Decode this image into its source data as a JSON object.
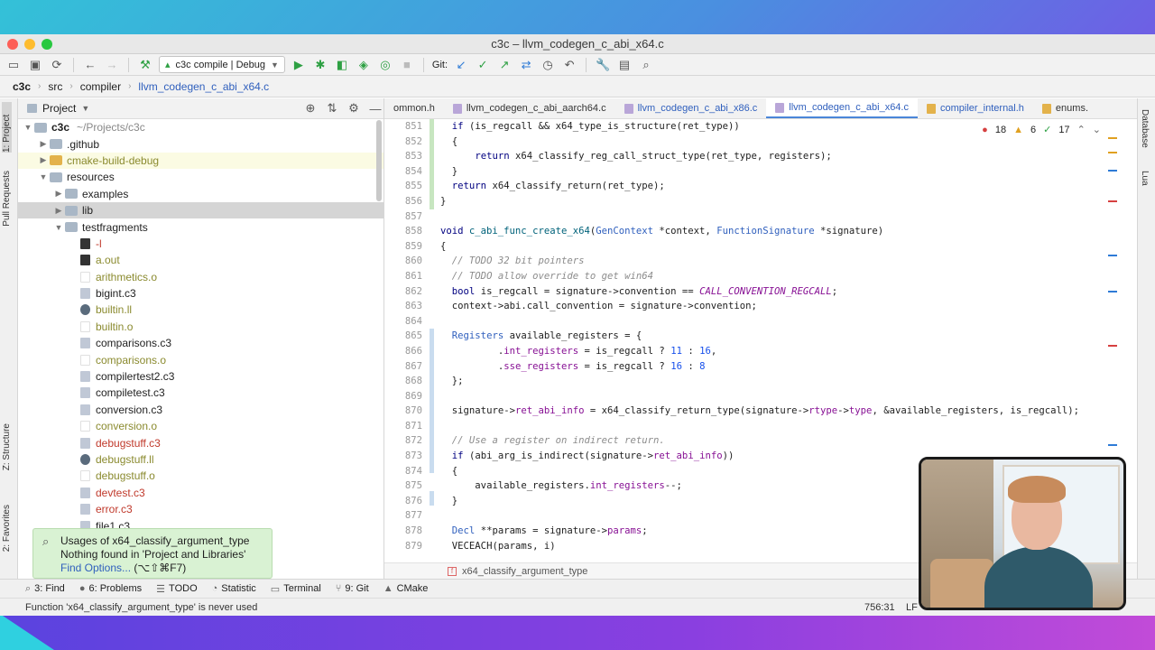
{
  "window": {
    "title": "c3c – llvm_codegen_c_abi_x64.c"
  },
  "toolbar": {
    "run_config": "c3c compile | Debug",
    "git_label": "Git:"
  },
  "navbar": {
    "crumbs": [
      "c3c",
      "src",
      "compiler",
      "llvm_codegen_c_abi_x64.c"
    ]
  },
  "left_strip": {
    "project": "1: Project",
    "pull_requests": "Pull Requests",
    "structure": "Z: Structure",
    "favorites": "2: Favorites"
  },
  "project_panel": {
    "title": "Project",
    "root_name": "c3c",
    "root_path": "~/Projects/c3c",
    "items": [
      {
        "name": ".github",
        "kind": "folder"
      },
      {
        "name": "cmake-build-debug",
        "kind": "folder-orange"
      },
      {
        "name": "resources",
        "kind": "folder"
      },
      {
        "name": "examples",
        "kind": "folder"
      },
      {
        "name": "lib",
        "kind": "folder"
      },
      {
        "name": "testfragments",
        "kind": "folder"
      },
      {
        "name": "-l",
        "kind": "bin"
      },
      {
        "name": "a.out",
        "kind": "bin"
      },
      {
        "name": "arithmetics.o",
        "kind": "o"
      },
      {
        "name": "bigint.c3",
        "kind": "c3"
      },
      {
        "name": "builtin.ll",
        "kind": "ll"
      },
      {
        "name": "builtin.o",
        "kind": "o"
      },
      {
        "name": "comparisons.c3",
        "kind": "c3"
      },
      {
        "name": "comparisons.o",
        "kind": "o"
      },
      {
        "name": "compilertest2.c3",
        "kind": "c3"
      },
      {
        "name": "compiletest.c3",
        "kind": "c3"
      },
      {
        "name": "conversion.c3",
        "kind": "c3"
      },
      {
        "name": "conversion.o",
        "kind": "o"
      },
      {
        "name": "debugstuff.c3",
        "kind": "c3"
      },
      {
        "name": "debugstuff.ll",
        "kind": "ll"
      },
      {
        "name": "debugstuff.o",
        "kind": "o"
      },
      {
        "name": "devtest.c3",
        "kind": "c3"
      },
      {
        "name": "error.c3",
        "kind": "c3"
      },
      {
        "name": "file1.c3",
        "kind": "c3"
      }
    ]
  },
  "find_popup": {
    "line1": "Usages of x64_classify_argument_type",
    "line2": "Nothing found in 'Project and Libraries'",
    "link": "Find Options...",
    "shortcut": "(⌥⇧⌘F7)"
  },
  "tabs": [
    "ommon.h",
    "llvm_codegen_c_abi_aarch64.c",
    "llvm_codegen_c_abi_x86.c",
    "llvm_codegen_c_abi_x64.c",
    "compiler_internal.h",
    "enums."
  ],
  "inspections": {
    "errors": "18",
    "warnings": "6",
    "ok": "17"
  },
  "line_numbers": [
    "851",
    "852",
    "853",
    "854",
    "855",
    "856",
    "857",
    "858",
    "859",
    "860",
    "861",
    "862",
    "863",
    "864",
    "865",
    "866",
    "867",
    "868",
    "869",
    "870",
    "871",
    "872",
    "873",
    "874",
    "875",
    "876",
    "877",
    "878",
    "879"
  ],
  "code_lines": [
    "if (is_regcall && x64_type_is_structure(ret_type))",
    "{",
    "    return x64_classify_reg_call_struct_type(ret_type, registers);",
    "}",
    "return x64_classify_return(ret_type);",
    "}",
    "",
    "void c_abi_func_create_x64(GenContext *context, FunctionSignature *signature)",
    "{",
    "// TODO 32 bit pointers",
    "// TODO allow override to get win64",
    "bool is_regcall = signature->convention == CALL_CONVENTION_REGCALL;",
    "context->abi.call_convention = signature->convention;",
    "",
    "Registers available_registers = {",
    "        .int_registers = is_regcall ? 11 : 16,",
    "        .sse_registers = is_regcall ? 16 : 8",
    "};",
    "",
    "signature->ret_abi_info = x64_classify_return_type(signature->rtype->type, &available_registers, is_regcall);",
    "",
    "// Use a register on indirect return.",
    "if (abi_arg_is_indirect(signature->ret_abi_info))",
    "{",
    "    available_registers.int_registers--;",
    "}",
    "",
    "Decl **params = signature->params;",
    "VECEACH(params, i)"
  ],
  "editor_breadcrumb": "x64_classify_argument_type",
  "right_strip": {
    "database": "Database",
    "lua": "Lua"
  },
  "bottom_tools": [
    {
      "label": "3: Find",
      "icon": "search-icon"
    },
    {
      "label": "6: Problems",
      "icon": "problems-icon"
    },
    {
      "label": "TODO",
      "icon": "list-icon"
    },
    {
      "label": "Statistic",
      "icon": "statistic-icon"
    },
    {
      "label": "Terminal",
      "icon": "terminal-icon"
    },
    {
      "label": "9: Git",
      "icon": "git-icon"
    },
    {
      "label": "CMake",
      "icon": "cmake-icon"
    }
  ],
  "status": {
    "message": "Function 'x64_classify_argument_type' is never used",
    "position": "756:31",
    "line_sep": "LF"
  }
}
